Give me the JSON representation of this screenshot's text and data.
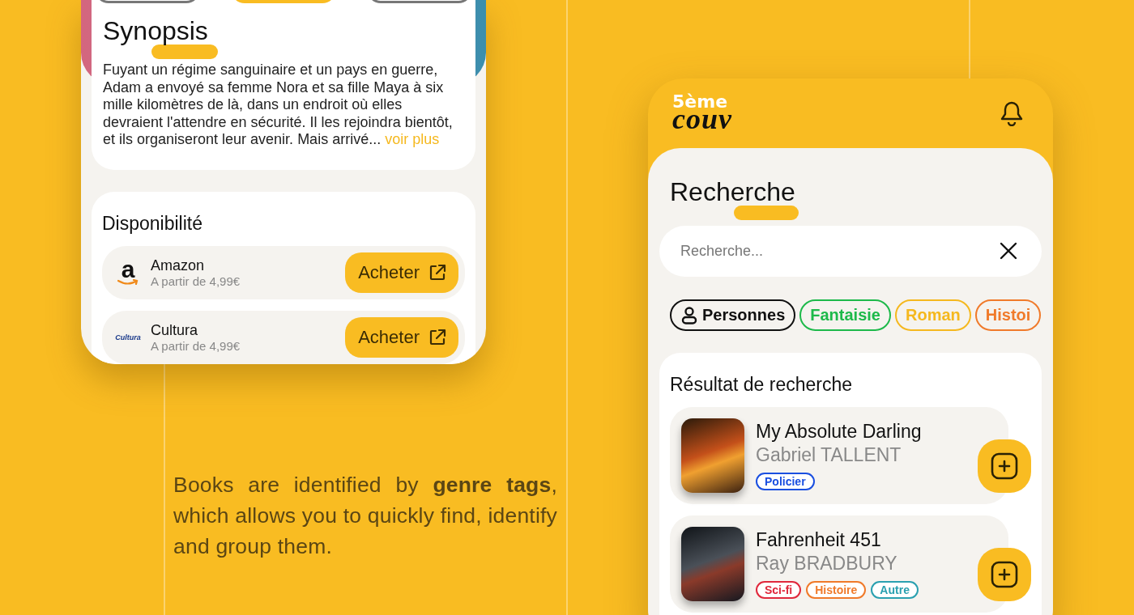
{
  "left_phone": {
    "tab_pills": [
      {
        "selected": false
      },
      {
        "selected": true
      },
      {
        "selected": false
      }
    ],
    "synopsis": {
      "title": "Synopsis",
      "text": "Fuyant un régime sanguinaire et un pays en guerre, Adam a envoyé sa femme Nora et sa fille Maya à six mille kilomètres de là, dans un endroit où elles devraient l'attendre en sécurité. Il les rejoindra bientôt, et ils organiseront leur avenir. Mais arrivé...",
      "more_link": "voir plus"
    },
    "availability": {
      "title": "Disponibilité",
      "stores": [
        {
          "kind": "amazon",
          "logo_text": "a",
          "name": "Amazon",
          "price": "A partir de 4,99€",
          "button": "Acheter"
        },
        {
          "kind": "cultura",
          "logo_text": "Cultura",
          "name": "Cultura",
          "price": "A partir de 4,99€",
          "button": "Acheter"
        }
      ]
    }
  },
  "caption": "Books are identified by **genre tags**, which allows you to quickly find, identify and group them.",
  "right_phone": {
    "logo": {
      "top": "5ème",
      "bottom": "couv"
    },
    "title": "Recherche",
    "search": {
      "placeholder": "Recherche..."
    },
    "chips": [
      {
        "kind": "people",
        "label": "Personnes",
        "color": "#111111"
      },
      {
        "kind": "genre",
        "label": "Fantaisie",
        "color": "#1db94a"
      },
      {
        "kind": "genre",
        "label": "Roman",
        "color": "#f5b81e"
      },
      {
        "kind": "genre",
        "label": "Histoi",
        "color": "#f07a2a"
      }
    ],
    "results": {
      "title": "Résultat de recherche",
      "books": [
        {
          "title": "My Absolute Darling",
          "author": "Gabriel TALLENT",
          "tags": [
            {
              "label": "Policier",
              "color": "#1a4fe0"
            }
          ]
        },
        {
          "title": "Fahrenheit 451",
          "author": "Ray BRADBURY",
          "tags": [
            {
              "label": "Sci-fi",
              "color": "#e0283c"
            },
            {
              "label": "Histoire",
              "color": "#f07a2a"
            },
            {
              "label": "Autre",
              "color": "#2aa0b0"
            }
          ]
        }
      ]
    }
  }
}
